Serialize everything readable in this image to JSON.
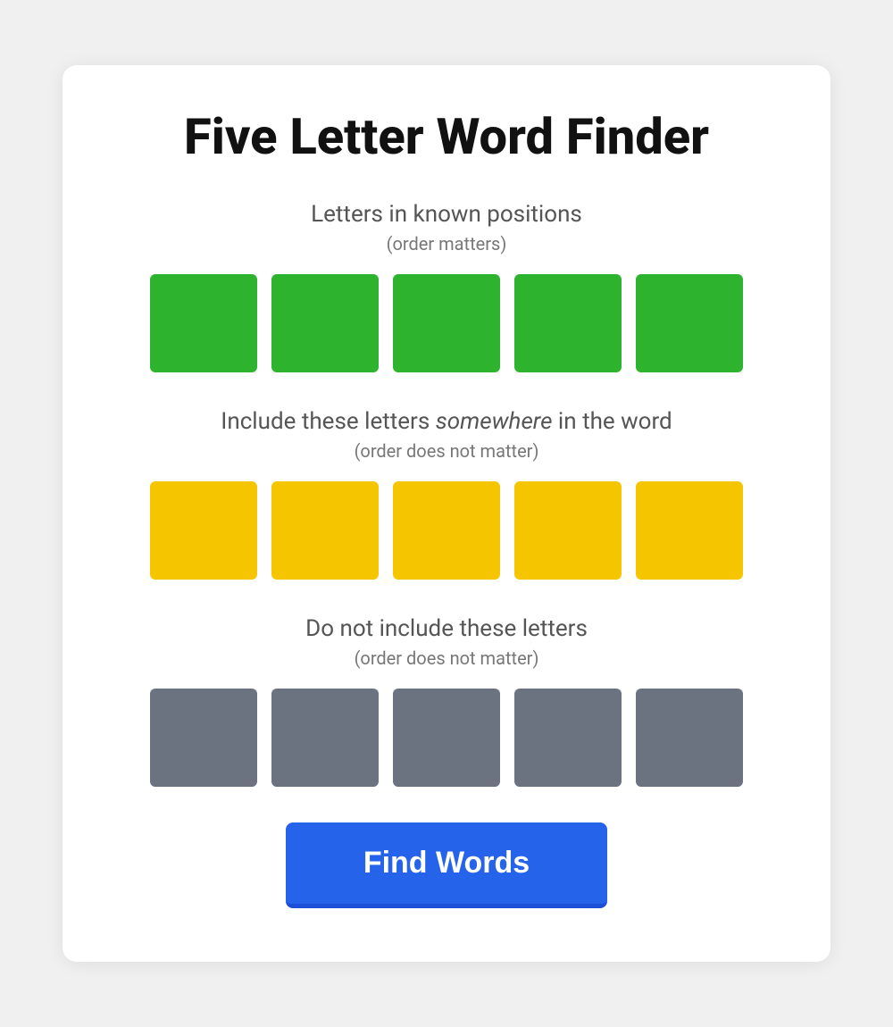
{
  "page": {
    "title": "Five Letter Word Finder",
    "sections": {
      "known_positions": {
        "title": "Letters in known positions",
        "subtitle": "(order matters)",
        "tile_color": "green",
        "tiles": [
          "",
          "",
          "",
          "",
          ""
        ]
      },
      "include_letters": {
        "title_prefix": "Include these letters ",
        "title_italic": "somewhere",
        "title_suffix": " in the word",
        "subtitle": "(order does not matter)",
        "tile_color": "yellow",
        "tiles": [
          "",
          "",
          "",
          "",
          ""
        ]
      },
      "exclude_letters": {
        "title": "Do not include these letters",
        "subtitle": "(order does not matter)",
        "tile_color": "gray",
        "tiles": [
          "",
          "",
          "",
          "",
          ""
        ]
      }
    },
    "find_words_button": "Find Words"
  }
}
